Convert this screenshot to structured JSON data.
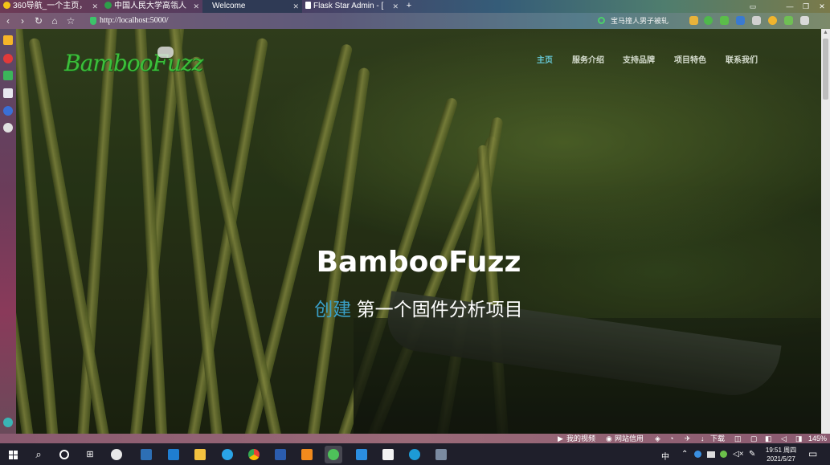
{
  "browser": {
    "tabs": [
      {
        "label": "360导航_一个主页，",
        "active": false
      },
      {
        "label": "中国人民大学高瓴人",
        "active": false
      },
      {
        "label": "Welcome",
        "active": true
      },
      {
        "label": "Flask Star Admin - [",
        "active": false
      }
    ],
    "new_tab": "+",
    "window_controls": [
      "▭",
      "—",
      "❐",
      "✕"
    ],
    "nav": {
      "back": "‹",
      "forward": "›",
      "reload": "↻",
      "home": "⌂",
      "favorite": "☆"
    },
    "url": "http://localhost:5000/",
    "search_text": "宝马撞人男子被轧",
    "zoom": "145%"
  },
  "site": {
    "logo": "BambooFuzz",
    "nav": [
      {
        "label": "主页",
        "active": true
      },
      {
        "label": "服务介绍",
        "active": false
      },
      {
        "label": "支持品牌",
        "active": false
      },
      {
        "label": "项目特色",
        "active": false
      },
      {
        "label": "联系我们",
        "active": false
      }
    ],
    "hero": {
      "title": "BambooFuzz",
      "subtitle_accent": "创建",
      "subtitle_rest": " 第一个固件分析项目"
    }
  },
  "statusbar": {
    "items": [
      "我的视频",
      "网站信用",
      "下载"
    ]
  },
  "taskbar": {
    "clock_time": "19:51 周四",
    "clock_date": "2021/5/27",
    "ime": "中"
  },
  "colors": {
    "nav_active": "#67c8d6",
    "subtitle_accent": "#3aa0c8",
    "logo_green": "#3cbf3a"
  }
}
